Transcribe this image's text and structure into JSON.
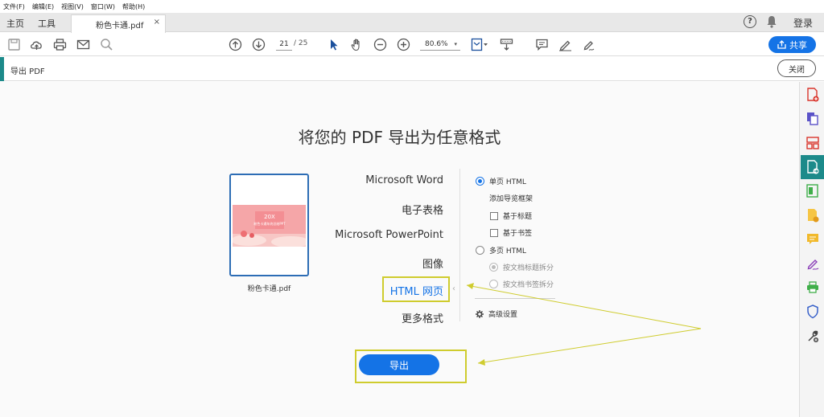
{
  "menu": [
    "文件(F)",
    "编辑(E)",
    "视图(V)",
    "窗口(W)",
    "帮助(H)"
  ],
  "tabs": {
    "home": "主页",
    "tools": "工具",
    "document": "粉色卡通.pdf",
    "close": "×"
  },
  "header_right": {
    "help": "?",
    "login": "登录"
  },
  "toolbar": {
    "page_current": "21",
    "page_total": "/ 25",
    "zoom": "80.6%",
    "zoom_arrow": "▾",
    "share_label": "共享"
  },
  "export_bar": {
    "label": "导出 PDF",
    "close_label": "关闭"
  },
  "main": {
    "heading": "将您的 PDF 导出为任意格式",
    "thumbnail_name": "粉色卡通.pdf",
    "thumbnail_text": {
      "big": "20X",
      "sub": "粉色卡通年终总结PPT"
    },
    "formats": [
      "Microsoft Word",
      "电子表格",
      "Microsoft PowerPoint",
      "图像",
      "HTML 网页",
      "更多格式"
    ],
    "selected_format": "HTML 网页",
    "options": {
      "single_page": "单页 HTML",
      "add_nav": "添加导览框架",
      "by_title": "基于标题",
      "by_bookmark": "基于书签",
      "multi_page": "多页 HTML",
      "split_by_title": "按文档标题拆分",
      "split_by_bookmark": "按文档书签拆分",
      "advanced": "高级设置"
    },
    "export_button": "导出"
  },
  "colors": {
    "accent": "#1473e6",
    "teal": "#1c8a8a",
    "annotation": "#cfcc2e"
  }
}
